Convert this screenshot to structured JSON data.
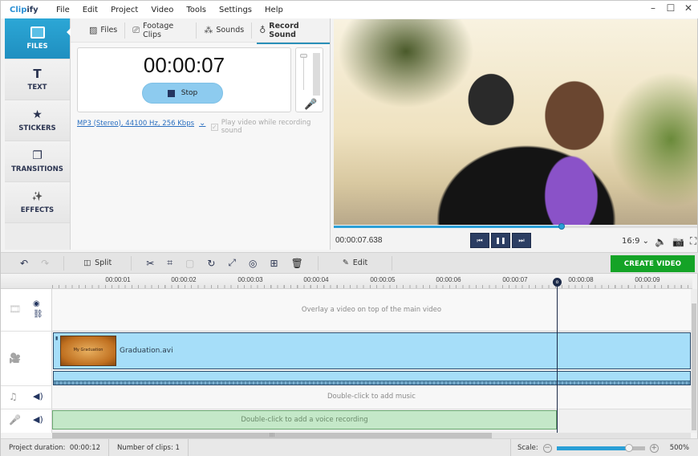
{
  "app": {
    "logo_a": "Clip",
    "logo_b": "ify"
  },
  "menu": [
    "File",
    "Edit",
    "Project",
    "Video",
    "Tools",
    "Settings",
    "Help"
  ],
  "window_controls": {
    "minimize": "–",
    "maximize": "☐",
    "close": "✕"
  },
  "sidebar": {
    "items": [
      {
        "label": "FILES",
        "icon": "image-icon",
        "glyph": "",
        "active": true
      },
      {
        "label": "TEXT",
        "icon": "text-icon",
        "glyph": "T"
      },
      {
        "label": "STICKERS",
        "icon": "star-icon",
        "glyph": "★"
      },
      {
        "label": "TRANSITIONS",
        "icon": "transitions-icon",
        "glyph": "❐"
      },
      {
        "label": "EFFECTS",
        "icon": "magic-wand-icon",
        "glyph": "✨"
      }
    ]
  },
  "panel": {
    "tabs": [
      {
        "label": "Files",
        "glyph": "🖼"
      },
      {
        "label": "Footage Clips",
        "glyph": "🎥"
      },
      {
        "label": "Sounds",
        "glyph": "〰"
      },
      {
        "label": "Record Sound",
        "glyph": "🎙",
        "active": true
      }
    ],
    "timer": "00:00:07",
    "stop_label": "Stop",
    "format": "MP3 (Stereo), 44100 Hz, 256 Kbps",
    "format_chevron": "⌄",
    "play_video_label": "Play video while recording sound",
    "play_video_checked": true,
    "mic_glyph": "🎤"
  },
  "preview": {
    "time": "00:00:07.638",
    "progress": 0.627,
    "aspect": "16:9 ⌄",
    "transport": {
      "prev": "⏮",
      "pause": "❚❚",
      "next": "⏭"
    },
    "icons": {
      "volume": "🔈",
      "snapshot": "📷",
      "fullscreen": "⛶"
    }
  },
  "toolbar": {
    "undo": "↶",
    "redo": "↷",
    "split_label": "Split",
    "split_glyph": "◫",
    "cut": "✂",
    "crop": "⌗",
    "stabilize": "▢",
    "rotate": "↻",
    "resize": "⤢",
    "chroma": "◎",
    "insert": "⊞",
    "delete": "🗑",
    "edit_label": "Edit",
    "edit_glyph": "✎",
    "create_label": "CREATE VIDEO",
    "create_color": "#14a326"
  },
  "timeline": {
    "ruler": [
      "00:00:01",
      "00:00:02",
      "00:00:03",
      "00:00:04",
      "00:00:05",
      "00:00:06",
      "00:00:07",
      "00:00:08",
      "00:00:09"
    ],
    "overlay_hint": "Overlay a video on top of the main video",
    "clip_name": "Graduation.avi",
    "clip_thumb_text": "My Graduation",
    "music_hint": "Double-click to add music",
    "voice_hint": "Double-click to add a voice recording",
    "playhead_time_sec": 7.638,
    "icons": {
      "film": "🎞",
      "eye": "👁",
      "link": "🔗",
      "camera": "🎥",
      "note": "♫",
      "speaker": "🔊",
      "mic": "🎤"
    }
  },
  "status": {
    "duration_label": "Project duration:",
    "duration": "00:00:12",
    "clips_label": "Number of clips:",
    "clips": "1",
    "scale_label": "Scale:",
    "scale_minus": "−",
    "scale_plus": "+",
    "scale_value": "500%",
    "scale_fraction": 0.82
  }
}
